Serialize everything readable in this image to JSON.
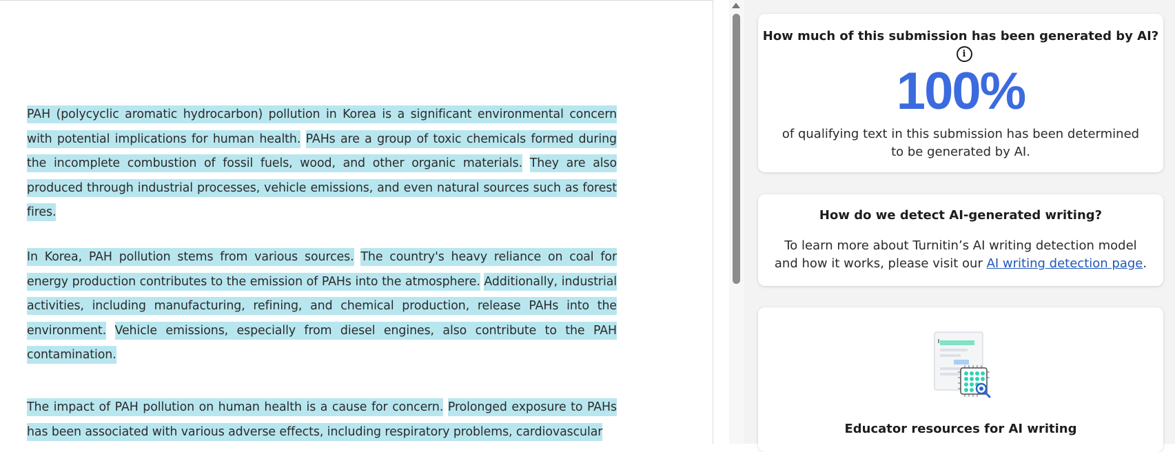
{
  "document": {
    "paragraphs": [
      {
        "sentences": [
          "PAH (polycyclic aromatic hydrocarbon) pollution in Korea is a significant environmental concern with potential implications for human health.",
          "PAHs are a group of toxic chemicals formed during the incomplete combustion of fossil fuels, wood, and other organic materials.",
          "They are also produced through industrial processes, vehicle emissions, and even natural sources such as forest fires."
        ]
      },
      {
        "sentences": [
          "In Korea, PAH pollution stems from various sources.",
          "The country's heavy reliance on coal for energy production contributes to the emission of PAHs into the atmosphere.",
          "Additionally, industrial activities, including manufacturing, refining, and chemical production, release PAHs into the environment.",
          "Vehicle emissions, especially from diesel engines, also contribute to the PAH contamination."
        ]
      },
      {
        "sentences": [
          "The impact of PAH pollution on human health is a cause for concern.",
          "Prolonged exposure to PAHs has been associated with various adverse effects, including respiratory problems, cardiovascular"
        ]
      }
    ],
    "highlight_color": "#b8e6ef"
  },
  "ai_panel": {
    "question": "How much of this submission has been generated by AI?",
    "info_icon": "info-icon",
    "percent": "100%",
    "percent_color": "#3b6bde",
    "description": "of qualifying text in this submission has been determined to be generated by AI."
  },
  "detect_panel": {
    "title": "How do we detect AI-generated writing?",
    "body_prefix": "To learn more about Turnitin’s AI writing detection model and how it works, please visit our ",
    "link_text": "AI writing detection page",
    "body_suffix": "."
  },
  "resources_panel": {
    "illustration_icon": "document-chip-magnifier-icon",
    "title": "Educator resources for AI writing"
  }
}
